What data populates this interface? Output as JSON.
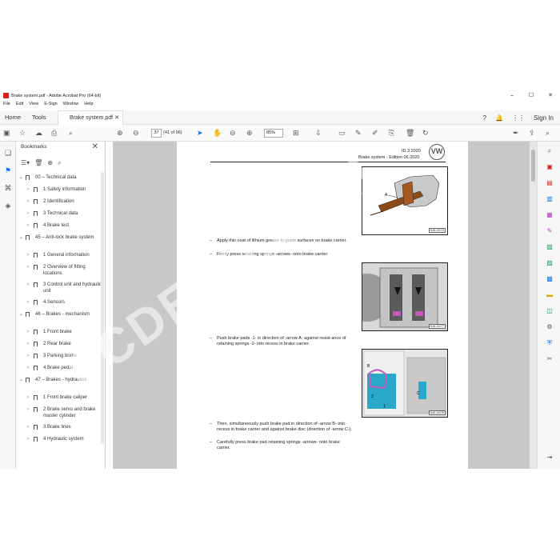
{
  "window": {
    "title": "Brake system.pdf - Adobe Acrobat Pro (64-bit)",
    "controls": [
      "–",
      "☐",
      "✕"
    ]
  },
  "menu": [
    "File",
    "Edit",
    "View",
    "E-Sign",
    "Window",
    "Help"
  ],
  "tabs": {
    "home": "Home",
    "tools": "Tools",
    "document": "Brake system.pdf",
    "sign_in": "Sign In"
  },
  "toolbar": {
    "page_number": "37",
    "page_count": "(41 of 96)",
    "zoom": "85%"
  },
  "bookmarks": {
    "title": "Bookmarks",
    "items": [
      {
        "label": "00 – Technical data",
        "level": 0,
        "expanded": true
      },
      {
        "label": "1 Safety information",
        "level": 1
      },
      {
        "label": "2 Identification",
        "level": 1
      },
      {
        "label": "3 Technical data",
        "level": 1
      },
      {
        "label": "4 Brake test",
        "level": 1
      },
      {
        "label": "45 – Anti-lock brake system",
        "level": 0,
        "expanded": true
      },
      {
        "label": "1 General information",
        "level": 1
      },
      {
        "label": "2 Overview of fitting locations",
        "level": 1
      },
      {
        "label": "3 Control unit and hydraulic unit",
        "level": 1
      },
      {
        "label": "4 Sensors",
        "level": 1
      },
      {
        "label": "46 – Brakes - mechanism",
        "level": 0,
        "expanded": true
      },
      {
        "label": "1 Front brake",
        "level": 1
      },
      {
        "label": "2 Rear brake",
        "level": 1
      },
      {
        "label": "3 Parking brake",
        "level": 1
      },
      {
        "label": "4 Brake pedal",
        "level": 1
      },
      {
        "label": "47 – Brakes - hydraulics",
        "level": 0,
        "expanded": true
      },
      {
        "label": "1 Front brake caliper",
        "level": 1
      },
      {
        "label": "2 Brake servo and brake master cylinder",
        "level": 1
      },
      {
        "label": "3 Brake lines",
        "level": 1
      },
      {
        "label": "4 Hydraulic system",
        "level": 1
      }
    ]
  },
  "document": {
    "header_id": "ID.3 2020",
    "header_title": "Brake system - Edition 06.2020",
    "logo_text": "VW",
    "steps": [
      "Apply thin coat of lithium grease to guide surfaces on brake carrier.",
      "Firmly press retaining springs -arrows- onto brake carrier.",
      "Push brake pads -1- in direction of -arrow A- against resist-ance of retaining springs -2- into recess in brake carrier.",
      "Then, simultaneously push brake pad in direction of -arrow B- into recess in brake carrier and against brake disc (direction of -arrow C-).",
      "Carefully press brake pad retaining springs -arrows- onto brake carrier."
    ],
    "figure_ids": [
      "N46-10473",
      "N46-10477",
      "N46-10478"
    ],
    "fig1_label": "A",
    "fig3_labels": [
      "B",
      "2",
      "1",
      "C"
    ]
  },
  "watermark": "PCDEPO.COM",
  "colors": {
    "accent": "#1473e6",
    "pdf_red": "#d4231e",
    "doc_background": "#c8c8c8"
  }
}
